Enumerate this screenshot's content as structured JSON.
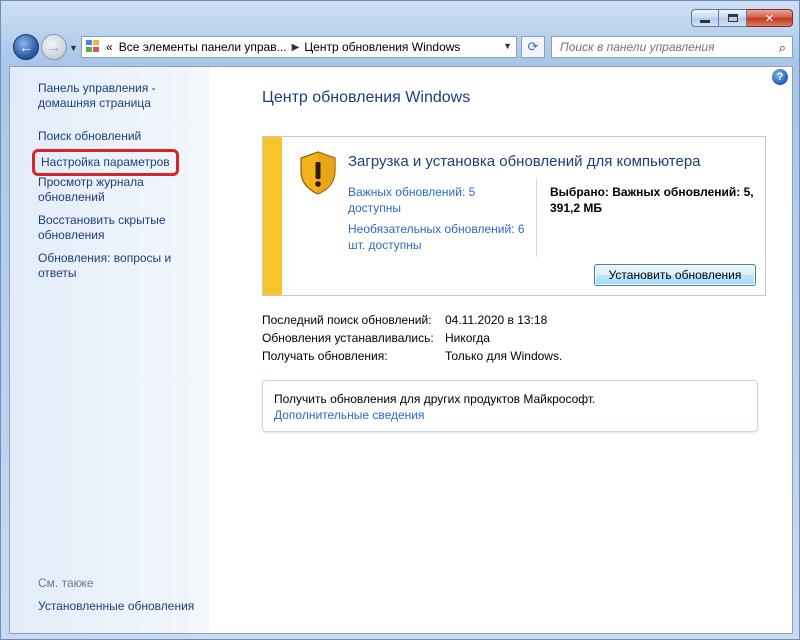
{
  "window": {
    "caption": {
      "minimize_icon": "minimize-icon",
      "maximize_icon": "maximize-icon",
      "close_glyph": "✕"
    }
  },
  "nav": {
    "back_glyph": "←",
    "forward_glyph": "→",
    "address_prefix": "«",
    "crumb1": "Все элементы панели управ...",
    "crumb_sep": "▶",
    "crumb2": "Центр обновления Windows",
    "search_placeholder": "Поиск в панели управления"
  },
  "sidebar": {
    "home": "Панель управления - домашняя страница",
    "check": "Поиск обновлений",
    "settings": "Настройка параметров",
    "history": "Просмотр журнала обновлений",
    "restore": "Восстановить скрытые обновления",
    "faq": "Обновления: вопросы и ответы",
    "see_also": "См. также",
    "installed": "Установленные обновления"
  },
  "main": {
    "title": "Центр обновления Windows",
    "update_box": {
      "headline": "Загрузка и установка обновлений для компьютера",
      "important_link": "Важных обновлений: 5 доступны",
      "optional_link": "Необязательных обновлений: 6 шт. доступны",
      "selected": "Выбрано: Важных обновлений: 5, 391,2 МБ",
      "install_button": "Установить обновления",
      "accent_color": "#f6c52a"
    },
    "info": {
      "last_check_label": "Последний поиск обновлений:",
      "last_check_value": "04.11.2020 в 13:18",
      "installed_label": "Обновления устанавливались:",
      "installed_value": "Никогда",
      "receive_label": "Получать обновления:",
      "receive_value": "Только для Windows."
    },
    "other": {
      "text": "Получить обновления для других продуктов Майкрософт.",
      "link": "Дополнительные сведения"
    }
  }
}
